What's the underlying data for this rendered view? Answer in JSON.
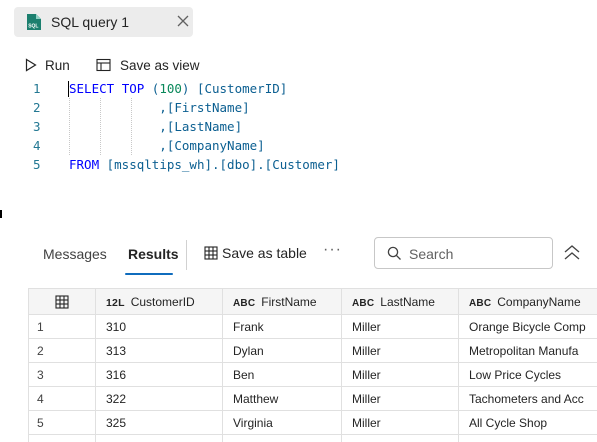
{
  "tab": {
    "title": "SQL query 1",
    "icon_label": "SQL"
  },
  "toolbar": {
    "run_label": "Run",
    "save_view_label": "Save as view"
  },
  "editor": {
    "lines": [
      {
        "num": "1",
        "text": "SELECT TOP (100) [CustomerID]"
      },
      {
        "num": "2",
        "text": "            ,[FirstName]"
      },
      {
        "num": "3",
        "text": "            ,[LastName]"
      },
      {
        "num": "4",
        "text": "            ,[CompanyName]"
      },
      {
        "num": "5",
        "text": "FROM [mssqltips_wh].[dbo].[Customer]"
      }
    ]
  },
  "results": {
    "tabs": {
      "messages": "Messages",
      "results": "Results"
    },
    "save_table_label": "Save as table",
    "more_label": "···",
    "search_placeholder": "Search",
    "columns": [
      {
        "type": "12L",
        "name": "CustomerID"
      },
      {
        "type": "ABC",
        "name": "FirstName"
      },
      {
        "type": "ABC",
        "name": "LastName"
      },
      {
        "type": "ABC",
        "name": "CompanyName"
      }
    ],
    "rows": [
      {
        "idx": "1",
        "cells": [
          "310",
          "Frank",
          "Miller",
          "Orange Bicycle Comp"
        ]
      },
      {
        "idx": "2",
        "cells": [
          "313",
          "Dylan",
          "Miller",
          "Metropolitan Manufa"
        ]
      },
      {
        "idx": "3",
        "cells": [
          "316",
          "Ben",
          "Miller",
          "Low Price Cycles"
        ]
      },
      {
        "idx": "4",
        "cells": [
          "322",
          "Matthew",
          "Miller",
          "Tachometers and Acc"
        ]
      },
      {
        "idx": "5",
        "cells": [
          "325",
          "Virginia",
          "Miller",
          "All Cycle Shop"
        ]
      }
    ]
  },
  "colors": {
    "accent": "#0f6cbd",
    "keyword": "#0000ff",
    "identifier": "#0b5f91",
    "number": "#09885a",
    "line_number": "#237893",
    "sql_icon": "#1b7f6e"
  }
}
